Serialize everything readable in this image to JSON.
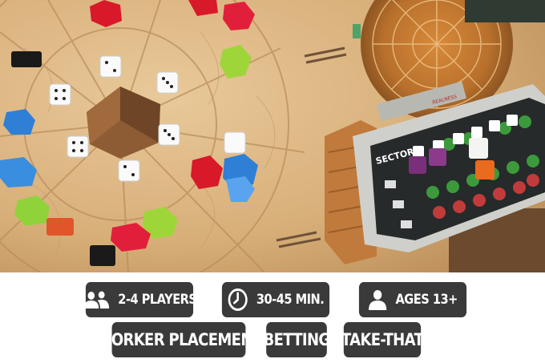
{
  "stats": [
    {
      "icon": "players-icon",
      "label": "2-4 PLAYERS"
    },
    {
      "icon": "clock-icon",
      "label": "30-45 MIN."
    },
    {
      "icon": "person-icon",
      "label": "AGES 13+"
    }
  ],
  "tags": [
    "WORKER PLACEMENT",
    "BETTING",
    "TAKE-THAT"
  ],
  "photo": {
    "board_label": "SECTOR",
    "card_label": "REALNESS"
  }
}
